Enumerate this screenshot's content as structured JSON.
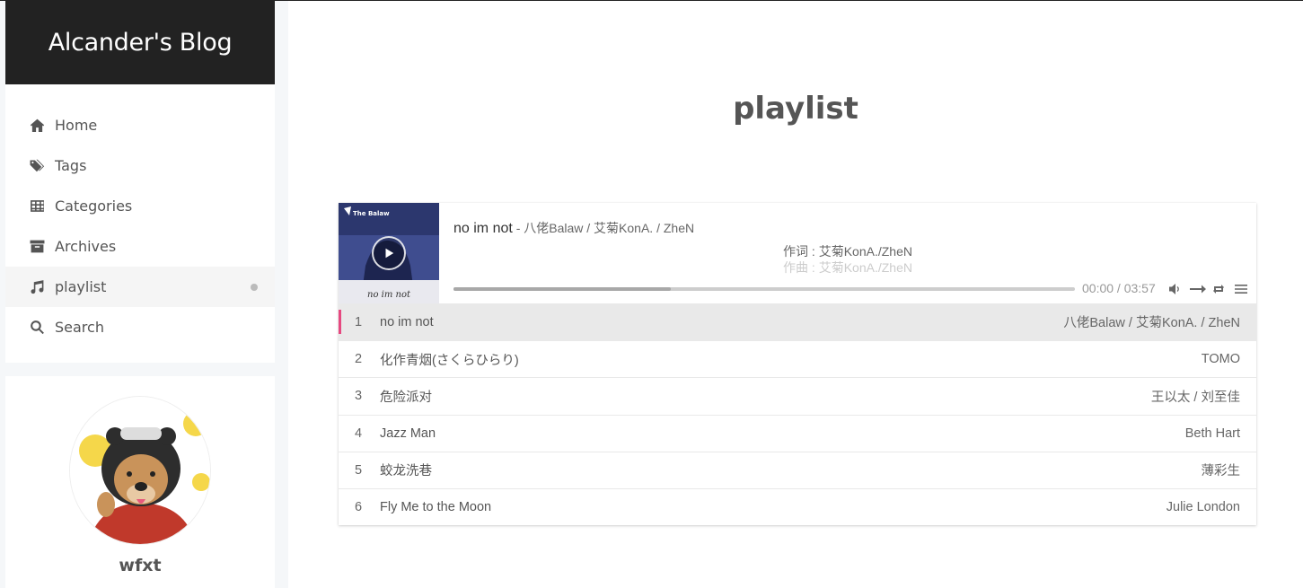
{
  "site": {
    "title": "Alcander's Blog"
  },
  "menu": [
    {
      "label": "Home",
      "icon": "home-icon"
    },
    {
      "label": "Tags",
      "icon": "tags-icon"
    },
    {
      "label": "Categories",
      "icon": "grid-icon"
    },
    {
      "label": "Archives",
      "icon": "archive-icon"
    },
    {
      "label": "playlist",
      "icon": "music-icon",
      "active": true
    },
    {
      "label": "Search",
      "icon": "search-icon"
    }
  ],
  "author": {
    "name": "wfxt"
  },
  "page": {
    "title": "playlist"
  },
  "player": {
    "cover_text_top": "The Balaw",
    "cover_text_bottom": "no im not",
    "current_title": "no im not",
    "current_author": " - 八佬Balaw / 艾菊KonA. / ZheN",
    "lyrics": [
      "作词 : 艾菊KonA./ZheN",
      "作曲 : 艾菊KonA./ZheN"
    ],
    "time": "00:00 / 03:57",
    "progress": 0.35,
    "accent": "#e64980",
    "controls": [
      "volume-icon",
      "order-icon",
      "loop-icon",
      "menu-icon"
    ]
  },
  "playlist": [
    {
      "index": "1",
      "title": "no im not",
      "artist": "八佬Balaw / 艾菊KonA. / ZheN"
    },
    {
      "index": "2",
      "title": "化作青烟(さくらひらり)",
      "artist": "TOMO"
    },
    {
      "index": "3",
      "title": "危险派对",
      "artist": "王以太 / 刘至佳"
    },
    {
      "index": "4",
      "title": "Jazz Man",
      "artist": "Beth Hart"
    },
    {
      "index": "5",
      "title": "蛟龙洗巷",
      "artist": "薄彩生"
    },
    {
      "index": "6",
      "title": "Fly Me to the Moon",
      "artist": "Julie London"
    }
  ]
}
